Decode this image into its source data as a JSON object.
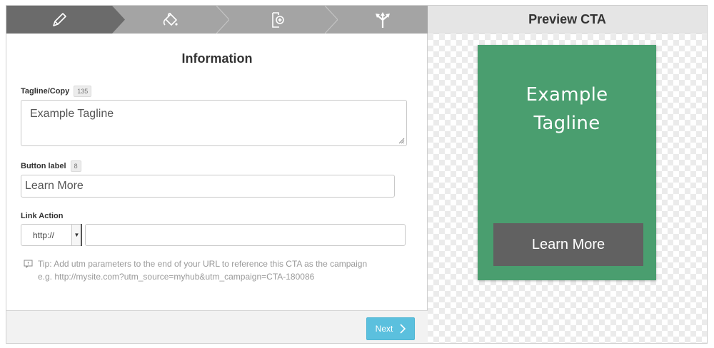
{
  "steps": [
    {
      "icon": "pencil-icon",
      "active": true
    },
    {
      "icon": "paint-bucket-icon",
      "active": false
    },
    {
      "icon": "add-page-icon",
      "active": false
    },
    {
      "icon": "split-arrows-icon",
      "active": false
    }
  ],
  "form": {
    "title": "Information",
    "tagline": {
      "label": "Tagline/Copy",
      "count": "135",
      "value": "Example Tagline"
    },
    "button_label": {
      "label": "Button label",
      "count": "8",
      "value": "Learn More"
    },
    "link_action": {
      "label": "Link Action",
      "protocol": "http://",
      "url": ""
    },
    "tip_line1": "Tip: Add utm parameters to the end of your URL to reference this CTA as the campaign",
    "tip_line2": "e.g. http://mysite.com?utm_source=myhub&utm_campaign=CTA-180086"
  },
  "footer": {
    "next_label": "Next"
  },
  "preview": {
    "title": "Preview CTA",
    "tagline": "Example Tagline",
    "button": "Learn More"
  },
  "colors": {
    "cta_background": "#4a9e6f",
    "cta_button": "#616161",
    "next_button": "#5bc0de",
    "active_step": "#6b6b6b",
    "inactive_step": "#a4a4a4"
  }
}
